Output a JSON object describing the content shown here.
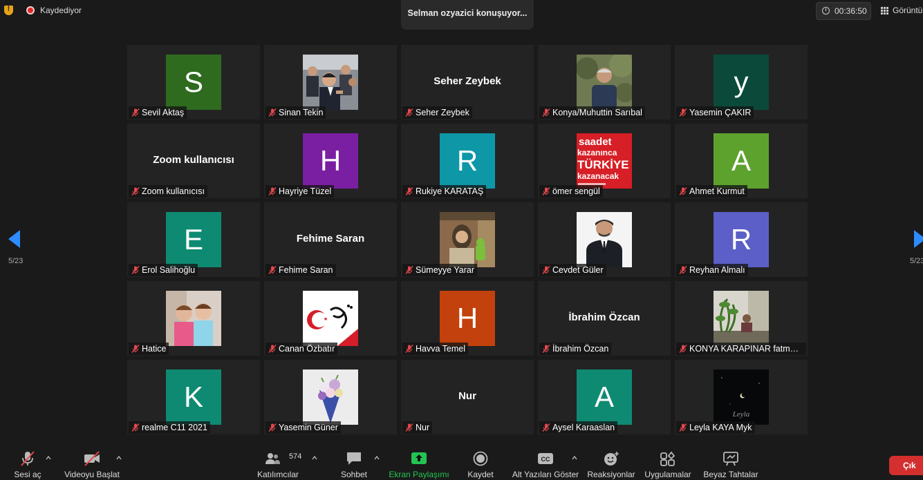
{
  "top": {
    "recording_label": "Kaydediyor",
    "speaker_label": "Selman ozyazici konuşuyor...",
    "timer": "00:36:50",
    "view_label": "Görüntü"
  },
  "paging": {
    "left": "5/23",
    "right": "5/23"
  },
  "participants": [
    {
      "name": "Sevil Aktaş",
      "kind": "avatar",
      "initial": "S",
      "color": "#2e6b1f"
    },
    {
      "name": "Sinan Tekin",
      "kind": "photo",
      "photo": "crowd-photo"
    },
    {
      "name": "Seher Zeybek",
      "kind": "text",
      "display": "Seher Zeybek"
    },
    {
      "name": "Konya/Muhuttin Sarıbal",
      "kind": "photo",
      "photo": "man-outdoors-photo"
    },
    {
      "name": "Yasemin ÇAKIR",
      "kind": "avatar",
      "initial": "y",
      "color": "#0b4a3a"
    },
    {
      "name": "Zoom kullanıcısı",
      "kind": "text",
      "display": "Zoom kullanıcısı"
    },
    {
      "name": "Hayriye Tüzel",
      "kind": "avatar",
      "initial": "H",
      "color": "#7b1fa2"
    },
    {
      "name": "Rukiye KARATAŞ",
      "kind": "avatar",
      "initial": "R",
      "color": "#0e97a7"
    },
    {
      "name": "ömer sengül",
      "kind": "photo",
      "photo": "slogan-poster",
      "poster_lines": [
        "saadet",
        "kazanınca",
        "TÜRKİYE",
        "kazanacak"
      ]
    },
    {
      "name": "Ahmet Kurmut",
      "kind": "avatar",
      "initial": "A",
      "color": "#5ea22e"
    },
    {
      "name": "Erol Salihoğlu",
      "kind": "avatar",
      "initial": "E",
      "color": "#0f8a72"
    },
    {
      "name": "Fehime Saran",
      "kind": "text",
      "display": "Fehime Saran"
    },
    {
      "name": "Sümeyye Yarar",
      "kind": "photo",
      "photo": "woman-photo"
    },
    {
      "name": "Cevdet Güler",
      "kind": "photo",
      "photo": "man-suit-photo"
    },
    {
      "name": "Reyhan Almalı",
      "kind": "avatar",
      "initial": "R",
      "color": "#5b5fc7"
    },
    {
      "name": "Hatice",
      "kind": "photo",
      "photo": "children-photo"
    },
    {
      "name": "Canan Özbatır",
      "kind": "photo",
      "photo": "flag-calligraphy-photo"
    },
    {
      "name": "Havva Temel",
      "kind": "avatar",
      "initial": "H",
      "color": "#c2410c"
    },
    {
      "name": "İbrahim Özcan",
      "kind": "text",
      "display": "İbrahim Özcan"
    },
    {
      "name": "KONYA KARAPINAR fatma ...",
      "kind": "photo",
      "photo": "plant-photo"
    },
    {
      "name": "realme C11 2021",
      "kind": "avatar",
      "initial": "K",
      "color": "#0f8a72"
    },
    {
      "name": "Yasemin Güner",
      "kind": "photo",
      "photo": "flowers-photo"
    },
    {
      "name": "Nur",
      "kind": "text",
      "display": "Nur"
    },
    {
      "name": "Aysel Karaaslan",
      "kind": "avatar",
      "initial": "A",
      "color": "#0f8a72"
    },
    {
      "name": "Leyla KAYA Myk",
      "kind": "photo",
      "photo": "night-moon-photo",
      "signature": "Leyla"
    }
  ],
  "toolbar": {
    "audio": "Sesi aç",
    "video": "Videoyu Başlat",
    "participants": "Katılımcılar",
    "participants_count": "574",
    "chat": "Sohbet",
    "share": "Ekran Paylaşımı",
    "record": "Kaydet",
    "captions": "Alt Yazıları Göster",
    "captions_badge": "CC",
    "reactions": "Reaksiyonlar",
    "apps": "Uygulamalar",
    "whiteboard": "Beyaz Tahtalar",
    "leave": "Çık"
  },
  "colors": {
    "accent": "#2d8cff",
    "share": "#23c552",
    "leave": "#d32f2f",
    "mute": "#e5484d"
  }
}
